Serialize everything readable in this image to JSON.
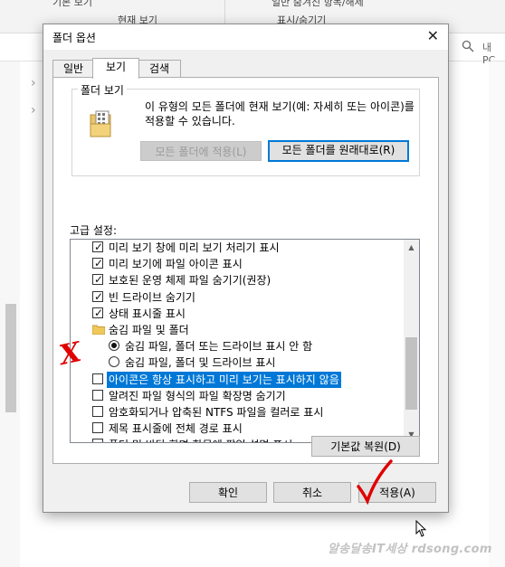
{
  "background": {
    "ribbon_left_fragment": "기본 보기",
    "ribbon_mid_label": "현재 보기",
    "ribbon_right_fragment": "표시/숨기기",
    "ribbon_right_top_fragment": "일반 숨겨진 항목/해제",
    "search_hint": "내 PC",
    "watermark": "알송달송IT세상 rdsong.com"
  },
  "dialog": {
    "title": "폴더 옵션",
    "close_glyph": "✕",
    "tabs": [
      {
        "label": "일반",
        "active": false
      },
      {
        "label": "보기",
        "active": true
      },
      {
        "label": "검색",
        "active": false
      }
    ],
    "folder_view": {
      "group_title": "폴더 보기",
      "description": "이 유형의 모든 폴더에 현재 보기(예: 자세히 또는 아이콘)를 적용할 수 있습니다.",
      "apply_button": "모든 폴더에 적용(L)",
      "reset_button": "모든 폴더를 원래대로(R)"
    },
    "advanced_label": "고급 설정:",
    "advanced_items": [
      {
        "type": "checkbox",
        "checked": true,
        "label": "미리 보기 창에 미리 보기 처리기 표시",
        "indent": 1
      },
      {
        "type": "checkbox",
        "checked": true,
        "label": "미리 보기에 파일 아이콘 표시",
        "indent": 1
      },
      {
        "type": "checkbox",
        "checked": true,
        "label": "보호된 운영 체제 파일 숨기기(권장)",
        "indent": 1
      },
      {
        "type": "checkbox",
        "checked": true,
        "label": "빈 드라이브 숨기기",
        "indent": 1
      },
      {
        "type": "checkbox",
        "checked": true,
        "label": "상태 표시줄 표시",
        "indent": 1
      },
      {
        "type": "folder",
        "label": "숨김 파일 및 폴더",
        "indent": 1
      },
      {
        "type": "radio",
        "checked": true,
        "label": "숨김 파일, 폴더 또는 드라이브 표시 안 함",
        "indent": 2
      },
      {
        "type": "radio",
        "checked": false,
        "label": "숨김 파일, 폴더 및 드라이브 표시",
        "indent": 2
      },
      {
        "type": "checkbox",
        "checked": false,
        "label": "아이콘은 항상 표시하고 미리 보기는 표시하지 않음",
        "indent": 1,
        "selected": true
      },
      {
        "type": "checkbox",
        "checked": false,
        "label": "알려진 파일 형식의 파일 확장명 숨기기",
        "indent": 1
      },
      {
        "type": "checkbox",
        "checked": false,
        "label": "암호화되거나 압축된 NTFS 파일을 컬러로 표시",
        "indent": 1
      },
      {
        "type": "checkbox",
        "checked": false,
        "label": "제목 표시줄에 전체 경로 표시",
        "indent": 1
      },
      {
        "type": "checkbox",
        "checked": false,
        "label": "폴더 및 바탕 화면 항목에 팝업 설명 표시",
        "indent": 1
      }
    ],
    "restore_defaults_button": "기본값 복원(D)",
    "ok_button": "확인",
    "cancel_button": "취소",
    "apply_button": "적용(A)",
    "annotation_x": "X"
  }
}
